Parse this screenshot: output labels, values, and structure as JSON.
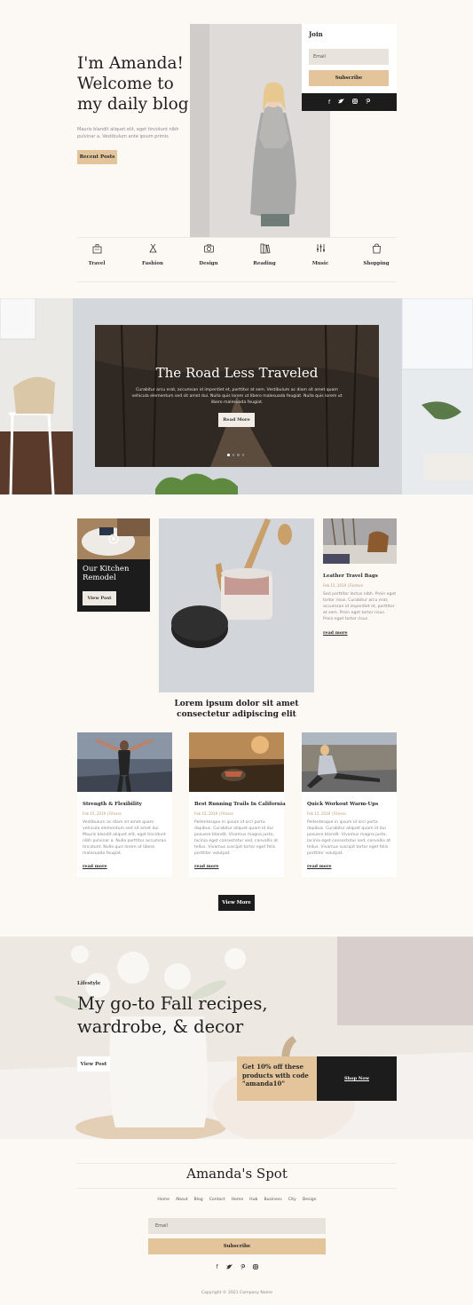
{
  "hero": {
    "title": "I'm Amanda! Welcome to my daily blog",
    "text": "Mauris blandit aliquet elit, eget tincidunt nibh pulvinar a. Vestibulum ante ipsum primis",
    "button": "Recent Posts"
  },
  "join": {
    "title": "Join",
    "email_placeholder": "Email",
    "subscribe": "Subscribe",
    "social": [
      "f",
      "t",
      "ig",
      "p"
    ]
  },
  "categories": [
    {
      "label": "Travel",
      "icon": "travel-icon"
    },
    {
      "label": "Fashion",
      "icon": "fashion-icon"
    },
    {
      "label": "Design",
      "icon": "camera-icon"
    },
    {
      "label": "Reading",
      "icon": "books-icon"
    },
    {
      "label": "Music",
      "icon": "music-icon"
    },
    {
      "label": "Shopping",
      "icon": "shopping-icon"
    }
  ],
  "slider": {
    "title": "The Road Less Traveled",
    "text": "Curabitur arcu erat, accumsan id imperdiet et, porttitor at sem. Vestibulum ac diam sit amet quam vehicula elementum sed sit amet dui. Nulla quis lorem ut libero malesuada feugiat. Nulla quis lorem ut libero malesuada feugiat.",
    "button": "Read More",
    "active_slide": 1,
    "slide_count": 4
  },
  "featured": {
    "kitchen_title": "Our Kitchen Remodel",
    "kitchen_button": "View Post",
    "main_title": "Lorem ipsum dolor sit amet consectetur adipiscing elit",
    "side_title": "Leather Travel Bags",
    "side_meta": "Feb 15, 2019 | Fashion",
    "side_text": "Sed porttitor lectus nibh. Proin eget tortor risus. Curabitur arcu erat, accumsan id imperdiet et, porttitor at sem. Proin eget tortor risus. Proin eget tortor risus.",
    "read_more": "read more"
  },
  "posts": [
    {
      "title": "Strength & Flexibility",
      "meta": "Feb 15, 2019 | Fitness",
      "text": "Vestibulum ac diam sit amet quam vehicula elementum sed sit amet dui. Mauris blandit aliquet elit, eget tincidunt nibh pulvinar a. Nulla porttitor accumsan tincidunt. Nulla quis lorem ut libero malesuada feugiat.",
      "read": "read more"
    },
    {
      "title": "Best Running Trails In California",
      "meta": "Feb 15, 2019 | Fitness",
      "text": "Pellentesque in ipsum id orci porta dapibus. Curabitur aliquet quam id dui posuere blandit. Vivamus magna justo, lacinia eget consectetur sed, convallis at tellus. Vivamus suscipit tortor eget felis porttitor volutpat.",
      "read": "read more"
    },
    {
      "title": "Quick Workout Warm-Ups",
      "meta": "Feb 15, 2019 | Fitness",
      "text": "Pellentesque in ipsum id orci porta dapibus. Curabitur aliquet quam id dui posuere blandit. Vivamus magna justo, lacinia eget consectetur sed, convallis at tellus. Vivamus suscipit tortor eget felis porttitor volutpat.",
      "read": "read more"
    }
  ],
  "view_more": "View More",
  "banner": {
    "tag": "Lifestyle",
    "title": "My go-to Fall recipes, wardrobe, & decor",
    "button": "View Post",
    "promo": "Get 10% off these products with code \"amanda10\"",
    "shop": "Shop Now"
  },
  "footer": {
    "logo": "Amanda's Spot",
    "nav": [
      "Home",
      "About",
      "Blog",
      "Contact",
      "Home",
      "Hub",
      "Business",
      "City",
      "Design"
    ],
    "email_placeholder": "Email",
    "subscribe": "Subscribe",
    "social": [
      "f",
      "t",
      "p",
      "ig"
    ],
    "copyright": "Copyright © 2021 Company Name"
  },
  "colors": {
    "accent": "#e4c49a",
    "dark": "#1c1c1c",
    "background": "#fcf9f5"
  }
}
